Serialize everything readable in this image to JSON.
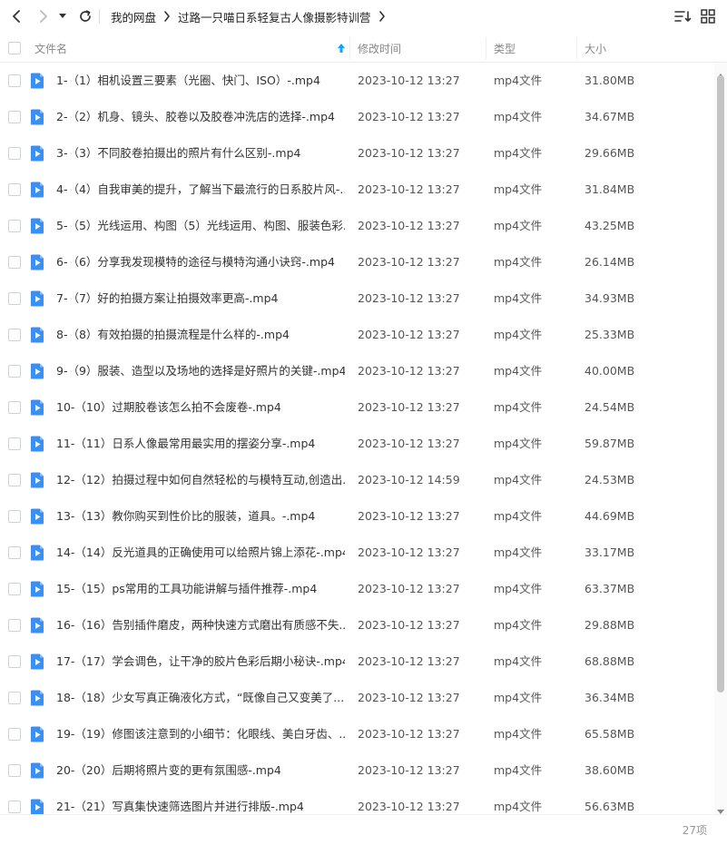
{
  "toolbar": {
    "breadcrumbs": [
      "我的网盘",
      "过路一只喵日系轻复古人像摄影特训营"
    ]
  },
  "header": {
    "name": "文件名",
    "mtime": "修改时间",
    "type": "类型",
    "size": "大小"
  },
  "files": [
    {
      "name": "1-（1）相机设置三要素（光圈、快门、ISO）-.mp4",
      "mtime": "2023-10-12 13:27",
      "type": "mp4文件",
      "size": "31.80MB"
    },
    {
      "name": "2-（2）机身、镜头、胶卷以及胶卷冲洗店的选择-.mp4",
      "mtime": "2023-10-12 13:27",
      "type": "mp4文件",
      "size": "34.67MB"
    },
    {
      "name": "3-（3）不同胶卷拍摄出的照片有什么区别-.mp4",
      "mtime": "2023-10-12 13:27",
      "type": "mp4文件",
      "size": "29.66MB"
    },
    {
      "name": "4-（4）自我审美的提升，了解当下最流行的日系胶片风-....",
      "mtime": "2023-10-12 13:27",
      "type": "mp4文件",
      "size": "31.84MB"
    },
    {
      "name": "5-（5）光线运用、构图（5）光线运用、构图、服装色彩...",
      "mtime": "2023-10-12 13:27",
      "type": "mp4文件",
      "size": "43.25MB"
    },
    {
      "name": "6-（6）分享我发现模特的途径与模特沟通小诀窍-.mp4",
      "mtime": "2023-10-12 13:27",
      "type": "mp4文件",
      "size": "26.14MB"
    },
    {
      "name": "7-（7）好的拍摄方案让拍摄效率更高-.mp4",
      "mtime": "2023-10-12 13:27",
      "type": "mp4文件",
      "size": "34.93MB"
    },
    {
      "name": "8-（8）有效拍摄的拍摄流程是什么样的-.mp4",
      "mtime": "2023-10-12 13:27",
      "type": "mp4文件",
      "size": "25.33MB"
    },
    {
      "name": "9-（9）服装、造型以及场地的选择是好照片的关键-.mp4",
      "mtime": "2023-10-12 13:27",
      "type": "mp4文件",
      "size": "40.00MB"
    },
    {
      "name": "10-（10）过期胶卷该怎么拍不会废卷-.mp4",
      "mtime": "2023-10-12 13:27",
      "type": "mp4文件",
      "size": "24.54MB"
    },
    {
      "name": "11-（11）日系人像最常用最实用的摆姿分享-.mp4",
      "mtime": "2023-10-12 13:27",
      "type": "mp4文件",
      "size": "59.87MB"
    },
    {
      "name": "12-（12）拍摄过程中如何自然轻松的与模特互动,创造出...",
      "mtime": "2023-10-12 14:59",
      "type": "mp4文件",
      "size": "24.53MB"
    },
    {
      "name": "13-（13）教你购买到性价比的服装，道具。-.mp4",
      "mtime": "2023-10-12 13:27",
      "type": "mp4文件",
      "size": "44.69MB"
    },
    {
      "name": "14-（14）反光道具的正确使用可以给照片锦上添花-.mp4",
      "mtime": "2023-10-12 13:27",
      "type": "mp4文件",
      "size": "33.17MB"
    },
    {
      "name": "15-（15）ps常用的工具功能讲解与插件推荐-.mp4",
      "mtime": "2023-10-12 13:27",
      "type": "mp4文件",
      "size": "63.37MB"
    },
    {
      "name": "16-（16）告别插件磨皮，两种快速方式磨出有质感不失...",
      "mtime": "2023-10-12 13:27",
      "type": "mp4文件",
      "size": "29.88MB"
    },
    {
      "name": "17-（17）学会调色，让干净的胶片色彩后期小秘诀-.mp4",
      "mtime": "2023-10-12 13:27",
      "type": "mp4文件",
      "size": "68.88MB"
    },
    {
      "name": "18-（18）少女写真正确液化方式，“既像自己又变美了...",
      "mtime": "2023-10-12 13:27",
      "type": "mp4文件",
      "size": "36.34MB"
    },
    {
      "name": "19-（19）修图该注意到的小细节：化眼线、美白牙齿、...",
      "mtime": "2023-10-12 13:27",
      "type": "mp4文件",
      "size": "65.58MB"
    },
    {
      "name": "20-（20）后期将照片变的更有氛围感-.mp4",
      "mtime": "2023-10-12 13:27",
      "type": "mp4文件",
      "size": "38.60MB"
    },
    {
      "name": "21-（21）写真集快速筛选图片并进行排版-.mp4",
      "mtime": "2023-10-12 13:27",
      "type": "mp4文件",
      "size": "56.63MB"
    }
  ],
  "footer": {
    "count": "27项"
  },
  "colors": {
    "accent": "#06a7ff",
    "icon_blue": "#3b8ff3"
  }
}
